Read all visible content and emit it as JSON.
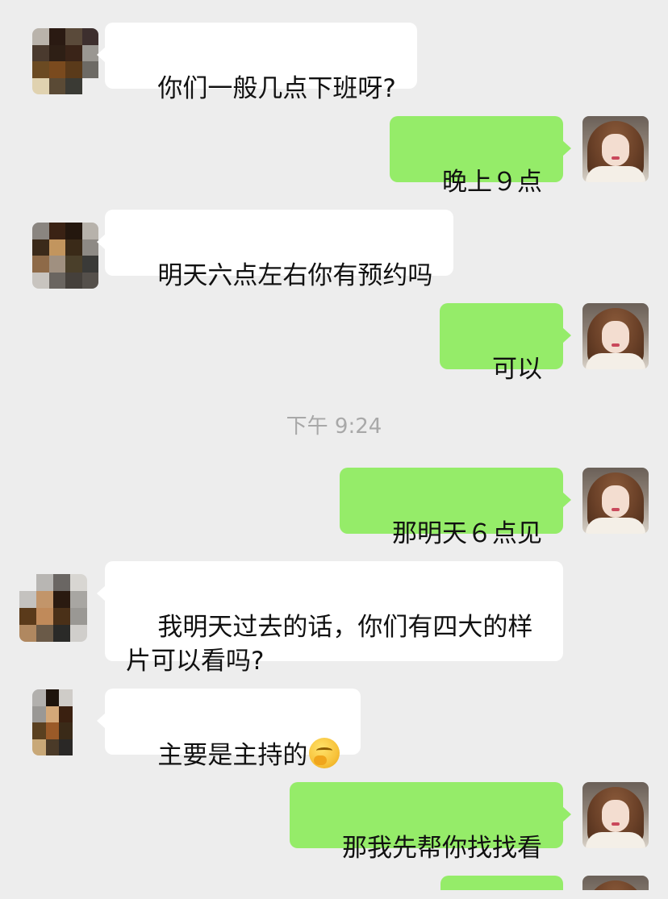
{
  "messages": [
    {
      "side": "left",
      "text": "你们一般几点下班呀?"
    },
    {
      "side": "right",
      "text": "晚上９点"
    },
    {
      "side": "left",
      "text": "明天六点左右你有预约吗"
    },
    {
      "side": "right",
      "text": "可以"
    },
    {
      "side": "right",
      "text": "那明天６点见"
    },
    {
      "side": "left",
      "text": "我明天过去的话，你们有四大的样\n片可以看吗?"
    },
    {
      "side": "left",
      "text": "主要是主持的",
      "emoji": "thinking-face-emoji"
    },
    {
      "side": "right",
      "text": "那我先帮你找找看"
    }
  ],
  "timestamp": "下午 9:24",
  "colors": {
    "background": "#ededed",
    "incoming_bubble": "#ffffff",
    "outgoing_bubble": "#95ec69",
    "timestamp_text": "#a8a8a8"
  },
  "icons": {
    "contact_avatar": "pixelated-avatar",
    "own_avatar": "portrait-avatar",
    "emoji": "thinking-face-emoji"
  }
}
